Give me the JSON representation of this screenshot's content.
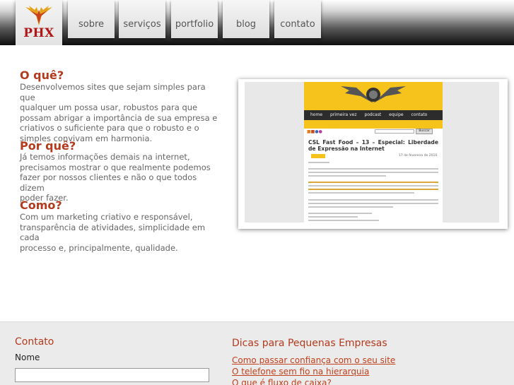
{
  "header": {
    "logo_text": "PHX",
    "nav": [
      "sobre",
      "serviços",
      "portfolio",
      "blog",
      "contato"
    ]
  },
  "sections": [
    {
      "heading": "O quê?",
      "lines": [
        "Desenvolvemos sites que sejam simples para que",
        "qualquer um possa usar, robustos para que",
        "possam abrigar a importância de sua empresa e",
        "criativos o suficiente para que o robusto e o",
        "simples convivam em harmonia."
      ]
    },
    {
      "heading": "Por quê?",
      "lines": [
        "Já temos informações demais na internet,",
        "precisamos mostrar o que realmente podemos",
        "fazer por nossos clientes e não o que todos dizem",
        "poder fazer."
      ]
    },
    {
      "heading": "Como?",
      "lines": [
        "Com um marketing criativo e responsável,",
        "transparência de atividades, simplicidade em cada",
        "processo e, principalmente, qualidade."
      ]
    }
  ],
  "preview": {
    "nav": [
      "home",
      "primeira vez",
      "podcast",
      "equipe",
      "contato"
    ],
    "search_button": "Buscar",
    "post_title": "CSL Fast Food – 13 – Especial: Liberdade de Expressão na Internet",
    "post_date": "17 de fevereiro de 2010"
  },
  "footer": {
    "contact_heading": "Contato",
    "name_label": "Nome",
    "tips_heading": "Dicas para Pequenas Empresas",
    "links": [
      "Como passar confiança com o seu site",
      "O telefone sem fio na hierarquia",
      "O que é fluxo de caixa?"
    ]
  },
  "colors": {
    "accent": "#b33a1d",
    "link": "#c2401c",
    "preview_yellow": "#f6c21c"
  }
}
